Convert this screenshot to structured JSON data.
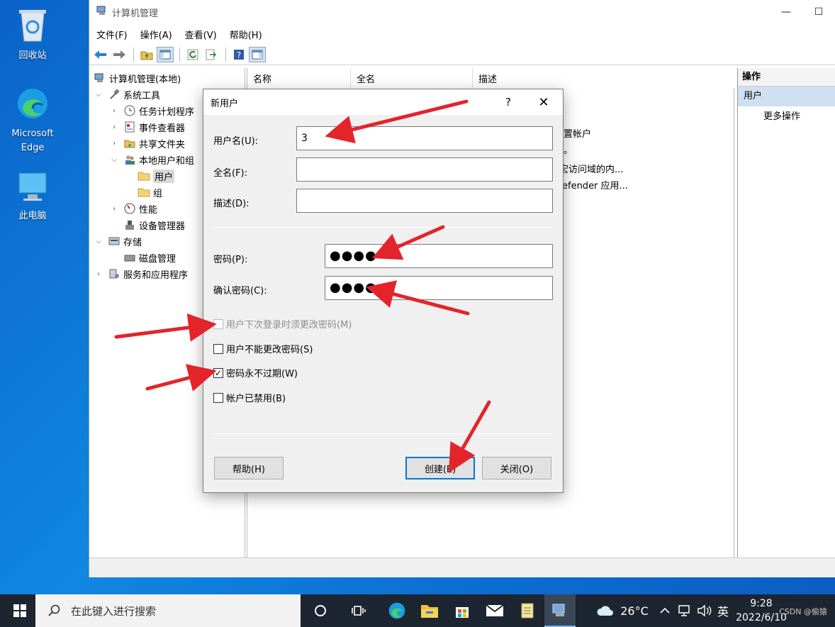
{
  "desktop": {
    "icons": [
      {
        "label": "回收站"
      },
      {
        "label": "Microsoft Edge"
      },
      {
        "label": "此电脑"
      }
    ]
  },
  "window": {
    "title": "计算机管理",
    "controls": {
      "minimize": "—",
      "maximize": "☐"
    },
    "menu": [
      "文件(F)",
      "操作(A)",
      "查看(V)",
      "帮助(H)"
    ],
    "tree": {
      "root": "计算机管理(本地)",
      "system_tools": "系统工具",
      "task_scheduler": "任务计划程序",
      "event_viewer": "事件查看器",
      "shared_folders": "共享文件夹",
      "local_users_groups": "本地用户和组",
      "users": "用户",
      "groups": "组",
      "performance": "性能",
      "device_manager": "设备管理器",
      "storage": "存储",
      "disk_management": "磁盘管理",
      "services_apps": "服务和应用程序"
    },
    "columns": [
      "名称",
      "全名",
      "描述"
    ],
    "desc_fragments": [
      "置帐户",
      "。",
      "宏访问域的内...",
      "efender 应用..."
    ],
    "actions": {
      "title": "操作",
      "section": "用户",
      "more": "更多操作"
    }
  },
  "dialog": {
    "title": "新用户",
    "help_icon": "?",
    "close_icon": "✕",
    "username_label": "用户名(U):",
    "username_value": "3",
    "fullname_label": "全名(F):",
    "fullname_value": "",
    "description_label": "描述(D):",
    "description_value": "",
    "password_label": "密码(P):",
    "password_value": "●●●●",
    "confirm_label": "确认密码(C):",
    "confirm_value": "●●●●",
    "checkboxes": [
      {
        "label": "用户下次登录时须更改密码(M)",
        "checked": false,
        "disabled": true
      },
      {
        "label": "用户不能更改密码(S)",
        "checked": false,
        "disabled": false
      },
      {
        "label": "密码永不过期(W)",
        "checked": true,
        "disabled": false
      },
      {
        "label": "帐户已禁用(B)",
        "checked": false,
        "disabled": false
      }
    ],
    "help_button": "帮助(H)",
    "create_button": "创建(E)",
    "close_button": "关闭(O)"
  },
  "taskbar": {
    "search_placeholder": "在此键入进行搜索",
    "weather": "26°C",
    "ime": "英",
    "time": "9:28",
    "date": "2022/6/10",
    "watermark": "CSDN @偷猿"
  },
  "colors": {
    "arrow": "#e3242b",
    "accent": "#0078d7",
    "desktop": "#1187e0",
    "taskbar": "#1c2530"
  }
}
